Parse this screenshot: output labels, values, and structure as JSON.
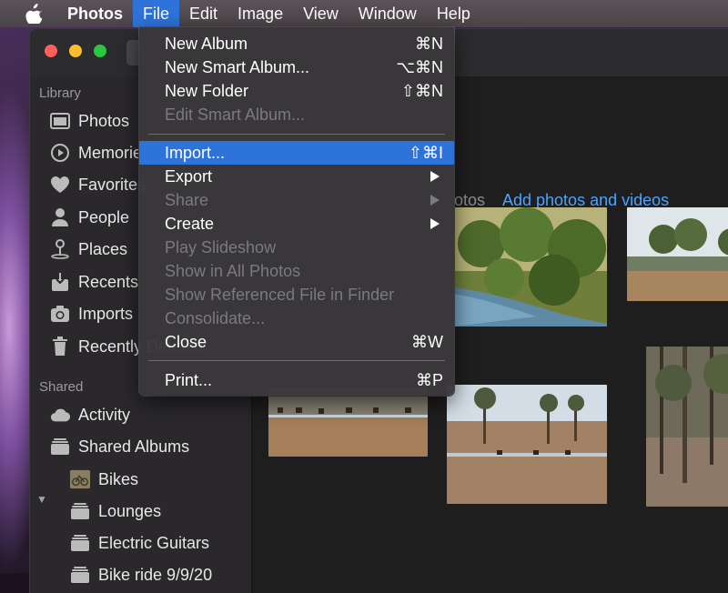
{
  "menubar": {
    "app_name": "Photos",
    "items": [
      "File",
      "Edit",
      "Image",
      "View",
      "Window",
      "Help"
    ]
  },
  "sidebar": {
    "library_title": "Library",
    "library_items": [
      "Photos",
      "Memories",
      "Favorites",
      "People",
      "Places",
      "Recents",
      "Imports",
      "Recently Deleted"
    ],
    "shared_title": "Shared",
    "shared_items": [
      "Activity",
      "Shared Albums"
    ],
    "albums": [
      "Bikes",
      "Lounges",
      "Electric Guitars",
      "Bike ride 9/9/20"
    ]
  },
  "content": {
    "tab_partial": "otos",
    "add_link": "Add photos and videos",
    "accent_color": "#4aa3ff"
  },
  "file_menu": {
    "new_album": {
      "label": "New Album",
      "shortcut": "⌘N"
    },
    "new_smart_album": {
      "label": "New Smart Album...",
      "shortcut": "⌥⌘N"
    },
    "new_folder": {
      "label": "New Folder",
      "shortcut": "⇧⌘N"
    },
    "edit_smart_album": {
      "label": "Edit Smart Album..."
    },
    "import": {
      "label": "Import...",
      "shortcut": "⇧⌘I"
    },
    "export": {
      "label": "Export"
    },
    "share": {
      "label": "Share"
    },
    "create": {
      "label": "Create"
    },
    "play_slideshow": {
      "label": "Play Slideshow"
    },
    "show_in_all_photos": {
      "label": "Show in All Photos"
    },
    "show_referenced": {
      "label": "Show Referenced File in Finder"
    },
    "consolidate": {
      "label": "Consolidate..."
    },
    "close": {
      "label": "Close",
      "shortcut": "⌘W"
    },
    "print": {
      "label": "Print...",
      "shortcut": "⌘P"
    }
  },
  "colors": {
    "highlight": "#2d73d9",
    "menubar": "#4f484c",
    "sidebar": "#2a282b"
  }
}
